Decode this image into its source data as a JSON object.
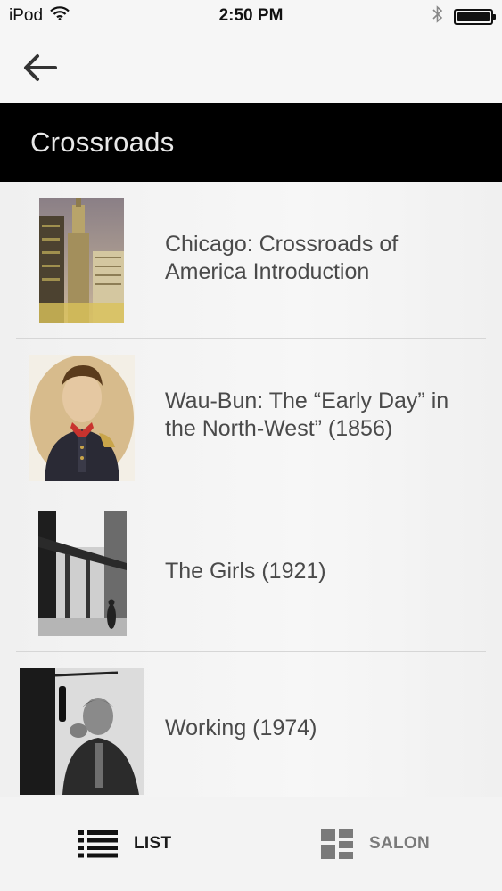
{
  "status_bar": {
    "carrier": "iPod",
    "time": "2:50 PM",
    "icons": [
      "wifi-icon",
      "bluetooth-icon",
      "battery-icon"
    ]
  },
  "nav": {
    "back_icon": "arrow-left-icon"
  },
  "header": {
    "title": "Crossroads"
  },
  "items": [
    {
      "title": "Chicago: Crossroads of America Introduction",
      "thumb": "skyscraper-photo"
    },
    {
      "title": "Wau-Bun: The “Early Day” in the North-West” (1856)",
      "thumb": "portrait-painting"
    },
    {
      "title": "The Girls (1921)",
      "thumb": "elevated-train-photo"
    },
    {
      "title": "Working (1974)",
      "thumb": "man-microphone-photo"
    }
  ],
  "tabs": {
    "list_label": "LIST",
    "salon_label": "SALON",
    "active": "LIST"
  },
  "colors": {
    "title_bar": "#000000",
    "active_tab": "#1a1a1a",
    "inactive_tab": "#7a7a7a"
  }
}
